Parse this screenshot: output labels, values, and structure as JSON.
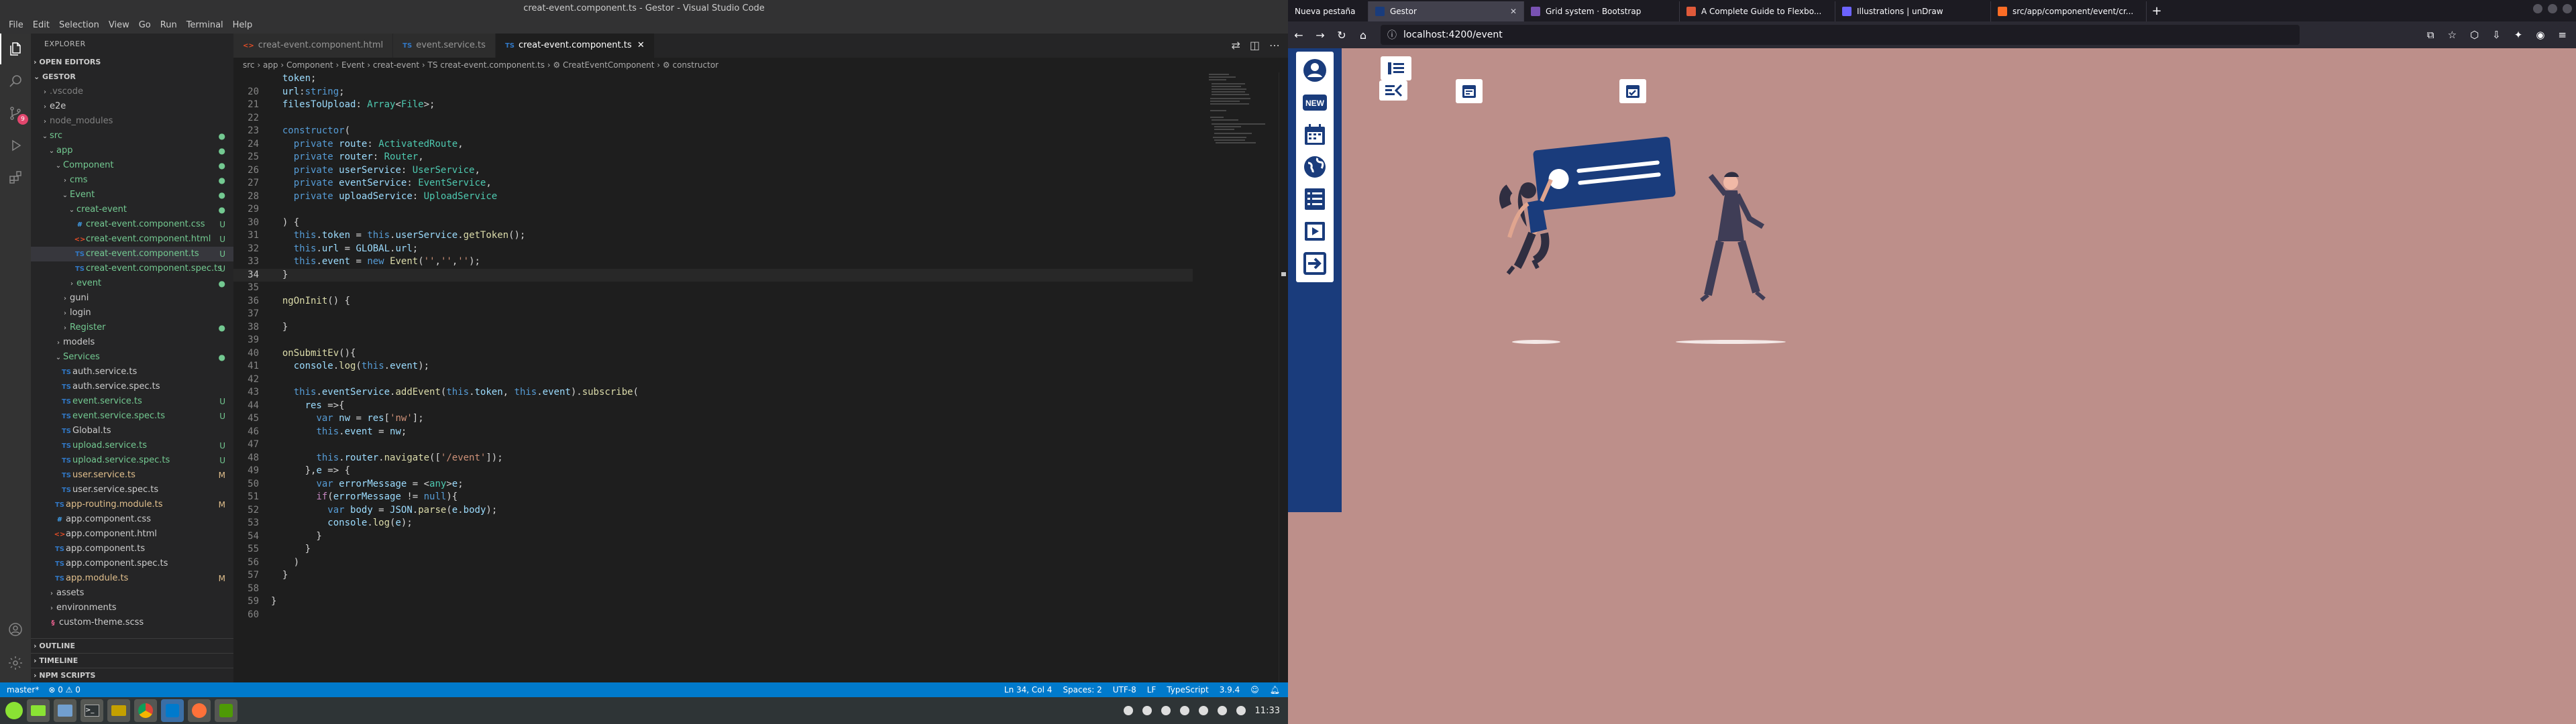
{
  "vscode": {
    "title": "creat-event.component.ts - Gestor - Visual Studio Code",
    "menu": [
      "File",
      "Edit",
      "Selection",
      "View",
      "Go",
      "Run",
      "Terminal",
      "Help"
    ],
    "explorer_title": "EXPLORER",
    "open_editors": "OPEN EDITORS",
    "workspace": "GESTOR",
    "tree": [
      {
        "label": ".vscode",
        "depth": 1,
        "type": "folder",
        "open": false,
        "badge": "",
        "color": "#808080"
      },
      {
        "label": "e2e",
        "depth": 1,
        "type": "folder",
        "open": false,
        "badge": "",
        "color": "#cccccc"
      },
      {
        "label": "node_modules",
        "depth": 1,
        "type": "folder",
        "open": false,
        "badge": "",
        "color": "#808080"
      },
      {
        "label": "src",
        "depth": 1,
        "type": "folder",
        "open": true,
        "badge": "●",
        "color": "#73c991"
      },
      {
        "label": "app",
        "depth": 2,
        "type": "folder",
        "open": true,
        "badge": "●",
        "color": "#73c991"
      },
      {
        "label": "Component",
        "depth": 3,
        "type": "folder",
        "open": true,
        "badge": "●",
        "color": "#73c991"
      },
      {
        "label": "cms",
        "depth": 4,
        "type": "folder",
        "open": false,
        "badge": "●",
        "color": "#73c991"
      },
      {
        "label": "Event",
        "depth": 4,
        "type": "folder",
        "open": true,
        "badge": "●",
        "color": "#73c991"
      },
      {
        "label": "creat-event",
        "depth": 5,
        "type": "folder",
        "open": true,
        "badge": "●",
        "color": "#73c991"
      },
      {
        "label": "creat-event.component.css",
        "depth": 6,
        "type": "css",
        "badge": "U",
        "color": "#73c991"
      },
      {
        "label": "creat-event.component.html",
        "depth": 6,
        "type": "html",
        "badge": "U",
        "color": "#73c991"
      },
      {
        "label": "creat-event.component.ts",
        "depth": 6,
        "type": "ts",
        "badge": "U",
        "color": "#73c991",
        "selected": true
      },
      {
        "label": "creat-event.component.spec.ts",
        "depth": 6,
        "type": "ts",
        "badge": "U",
        "color": "#73c991"
      },
      {
        "label": "event",
        "depth": 5,
        "type": "folder",
        "open": false,
        "badge": "●",
        "color": "#73c991"
      },
      {
        "label": "guni",
        "depth": 4,
        "type": "folder",
        "open": false,
        "badge": "",
        "color": "#cccccc"
      },
      {
        "label": "login",
        "depth": 4,
        "type": "folder",
        "open": false,
        "badge": "",
        "color": "#cccccc"
      },
      {
        "label": "Register",
        "depth": 4,
        "type": "folder",
        "open": false,
        "badge": "●",
        "color": "#73c991"
      },
      {
        "label": "models",
        "depth": 3,
        "type": "folder",
        "open": false,
        "badge": "",
        "color": "#cccccc"
      },
      {
        "label": "Services",
        "depth": 3,
        "type": "folder",
        "open": true,
        "badge": "●",
        "color": "#73c991"
      },
      {
        "label": "auth.service.ts",
        "depth": 4,
        "type": "ts",
        "badge": "",
        "color": "#cccccc"
      },
      {
        "label": "auth.service.spec.ts",
        "depth": 4,
        "type": "ts",
        "badge": "",
        "color": "#cccccc"
      },
      {
        "label": "event.service.ts",
        "depth": 4,
        "type": "ts",
        "badge": "U",
        "color": "#73c991"
      },
      {
        "label": "event.service.spec.ts",
        "depth": 4,
        "type": "ts",
        "badge": "U",
        "color": "#73c991"
      },
      {
        "label": "Global.ts",
        "depth": 4,
        "type": "ts",
        "badge": "",
        "color": "#cccccc"
      },
      {
        "label": "upload.service.ts",
        "depth": 4,
        "type": "ts",
        "badge": "U",
        "color": "#73c991"
      },
      {
        "label": "upload.service.spec.ts",
        "depth": 4,
        "type": "ts",
        "badge": "U",
        "color": "#73c991"
      },
      {
        "label": "user.service.ts",
        "depth": 4,
        "type": "ts",
        "badge": "M",
        "color": "#e2c08d"
      },
      {
        "label": "user.service.spec.ts",
        "depth": 4,
        "type": "ts",
        "badge": "",
        "color": "#cccccc"
      },
      {
        "label": "app-routing.module.ts",
        "depth": 3,
        "type": "ts",
        "badge": "M",
        "color": "#e2c08d"
      },
      {
        "label": "app.component.css",
        "depth": 3,
        "type": "css",
        "badge": "",
        "color": "#cccccc"
      },
      {
        "label": "app.component.html",
        "depth": 3,
        "type": "html",
        "badge": "",
        "color": "#cccccc"
      },
      {
        "label": "app.component.ts",
        "depth": 3,
        "type": "ts",
        "badge": "",
        "color": "#cccccc"
      },
      {
        "label": "app.component.spec.ts",
        "depth": 3,
        "type": "ts",
        "badge": "",
        "color": "#cccccc"
      },
      {
        "label": "app.module.ts",
        "depth": 3,
        "type": "ts",
        "badge": "M",
        "color": "#e2c08d"
      },
      {
        "label": "assets",
        "depth": 2,
        "type": "folder",
        "open": false,
        "badge": "",
        "color": "#cccccc"
      },
      {
        "label": "environments",
        "depth": 2,
        "type": "folder",
        "open": false,
        "badge": "",
        "color": "#cccccc"
      },
      {
        "label": "custom-theme.scss",
        "depth": 2,
        "type": "scss",
        "badge": "",
        "color": "#cccccc"
      }
    ],
    "bottom_sections": [
      "OUTLINE",
      "TIMELINE",
      "NPM SCRIPTS"
    ],
    "tabs": [
      {
        "label": "creat-event.component.html",
        "icon": "html",
        "active": false
      },
      {
        "label": "event.service.ts",
        "icon": "ts",
        "active": false
      },
      {
        "label": "creat-event.component.ts",
        "icon": "ts",
        "active": true
      }
    ],
    "breadcrumb": "src › app › Component › Event › creat-event › TS creat-event.component.ts › ⚙ CreatEventComponent › ⚙ constructor",
    "code_lines": [
      {
        "n": "",
        "html": "  <span class='v'>token</span>;"
      },
      {
        "n": "20",
        "html": "  <span class='v'>url</span>:<span class='kw'>string</span>;"
      },
      {
        "n": "21",
        "html": "  <span class='v'>filesToUpload</span>: <span class='t'>Array</span>&lt;<span class='t'>File</span>&gt;;"
      },
      {
        "n": "22",
        "html": ""
      },
      {
        "n": "23",
        "html": "  <span class='kw'>constructor</span>("
      },
      {
        "n": "24",
        "html": "    <span class='kw'>private</span> <span class='v'>route</span>: <span class='t'>ActivatedRoute</span>,"
      },
      {
        "n": "25",
        "html": "    <span class='kw'>private</span> <span class='v'>router</span>: <span class='t'>Router</span>,"
      },
      {
        "n": "26",
        "html": "    <span class='kw'>private</span> <span class='v'>userService</span>: <span class='t'>UserService</span>,"
      },
      {
        "n": "27",
        "html": "    <span class='kw'>private</span> <span class='v'>eventService</span>: <span class='t'>EventService</span>,"
      },
      {
        "n": "28",
        "html": "    <span class='kw'>private</span> <span class='v'>uploadService</span>: <span class='t'>UploadService</span>"
      },
      {
        "n": "29",
        "html": ""
      },
      {
        "n": "30",
        "html": "  ) {"
      },
      {
        "n": "31",
        "html": "    <span class='kw'>this</span>.<span class='v'>token</span> = <span class='kw'>this</span>.<span class='v'>userService</span>.<span class='f'>getToken</span>();"
      },
      {
        "n": "32",
        "html": "    <span class='kw'>this</span>.<span class='v'>url</span> = <span class='v'>GLOBAL</span>.<span class='v'>url</span>;"
      },
      {
        "n": "33",
        "html": "    <span class='kw'>this</span>.<span class='v'>event</span> = <span class='kw'>new</span> <span class='f'>Event</span>(<span class='s'>''</span>,<span class='s'>''</span>,<span class='s'>''</span>);"
      },
      {
        "n": "34",
        "html": "  }",
        "cur": true
      },
      {
        "n": "35",
        "html": ""
      },
      {
        "n": "36",
        "html": "  <span class='f'>ngOnInit</span>() {"
      },
      {
        "n": "37",
        "html": ""
      },
      {
        "n": "38",
        "html": "  }"
      },
      {
        "n": "39",
        "html": ""
      },
      {
        "n": "40",
        "html": "  <span class='f'>onSubmitEv</span>(){"
      },
      {
        "n": "41",
        "html": "    <span class='v'>console</span>.<span class='f'>log</span>(<span class='kw'>this</span>.<span class='v'>event</span>);"
      },
      {
        "n": "42",
        "html": ""
      },
      {
        "n": "43",
        "html": "    <span class='kw'>this</span>.<span class='v'>eventService</span>.<span class='f'>addEvent</span>(<span class='kw'>this</span>.<span class='v'>token</span>, <span class='kw'>this</span>.<span class='v'>event</span>).<span class='f'>subscribe</span>("
      },
      {
        "n": "44",
        "html": "      <span class='v'>res</span> =&gt;{"
      },
      {
        "n": "45",
        "html": "        <span class='kw'>var</span> <span class='v'>nw</span> = <span class='v'>res</span>[<span class='s'>'nw'</span>];"
      },
      {
        "n": "46",
        "html": "        <span class='kw'>this</span>.<span class='v'>event</span> = <span class='v'>nw</span>;"
      },
      {
        "n": "47",
        "html": ""
      },
      {
        "n": "48",
        "html": "        <span class='kw'>this</span>.<span class='v'>router</span>.<span class='f'>navigate</span>([<span class='s'>'/event'</span>]);"
      },
      {
        "n": "49",
        "html": "      },<span class='v'>e</span> =&gt; {"
      },
      {
        "n": "50",
        "html": "        <span class='kw'>var</span> <span class='v'>errorMessage</span> = &lt;<span class='t'>any</span>&gt;<span class='v'>e</span>;"
      },
      {
        "n": "51",
        "html": "        <span class='k'>if</span>(<span class='v'>errorMessage</span> != <span class='kw'>null</span>){"
      },
      {
        "n": "52",
        "html": "          <span class='kw'>var</span> <span class='v'>body</span> = <span class='v'>JSON</span>.<span class='f'>parse</span>(<span class='v'>e</span>.<span class='v'>body</span>);"
      },
      {
        "n": "53",
        "html": "          <span class='v'>console</span>.<span class='f'>log</span>(<span class='v'>e</span>);"
      },
      {
        "n": "54",
        "html": "        }"
      },
      {
        "n": "55",
        "html": "      }"
      },
      {
        "n": "56",
        "html": "    )"
      },
      {
        "n": "57",
        "html": "  }"
      },
      {
        "n": "58",
        "html": ""
      },
      {
        "n": "59",
        "html": "}"
      },
      {
        "n": "60",
        "html": ""
      }
    ],
    "status_left": [
      "master*",
      "⊗ 0 ⚠ 0"
    ],
    "status_right": [
      "Ln 34, Col 4",
      "Spaces: 2",
      "UTF-8",
      "LF",
      "TypeScript",
      "3.9.4"
    ]
  },
  "browser": {
    "tabs": [
      {
        "label": "Nueva pestaña",
        "active": false,
        "fav": "#54535c"
      },
      {
        "label": "Gestor",
        "active": true,
        "fav": "#1a3c7c"
      },
      {
        "label": "Grid system · Bootstrap",
        "active": false,
        "fav": "#7952b3"
      },
      {
        "label": "A Complete Guide to Flexbo...",
        "active": false,
        "fav": "#e05a3a"
      },
      {
        "label": "Illustrations | unDraw",
        "active": false,
        "fav": "#6c63ff"
      },
      {
        "label": "src/app/component/event/cr...",
        "active": false,
        "fav": "#fc6d26"
      }
    ],
    "url": "localhost:4200/event",
    "sidebar_buttons": [
      "user-icon",
      "new-icon",
      "calendar-icon",
      "globe-icon",
      "list-icon",
      "video-icon",
      "logout-icon"
    ],
    "new_label": "NEW"
  },
  "taskbar": {
    "apps": [
      "menu-icon",
      "files-icon",
      "image-icon",
      "terminal-icon",
      "folder-icon",
      "chrome-icon",
      "vscode-icon",
      "firefox-icon",
      "todo-icon"
    ],
    "clock": "11:33"
  },
  "colors": {
    "sidebar_blue": "#1a3c7c",
    "page_bg": "#bd8f8a",
    "statusbar": "#007acc"
  }
}
